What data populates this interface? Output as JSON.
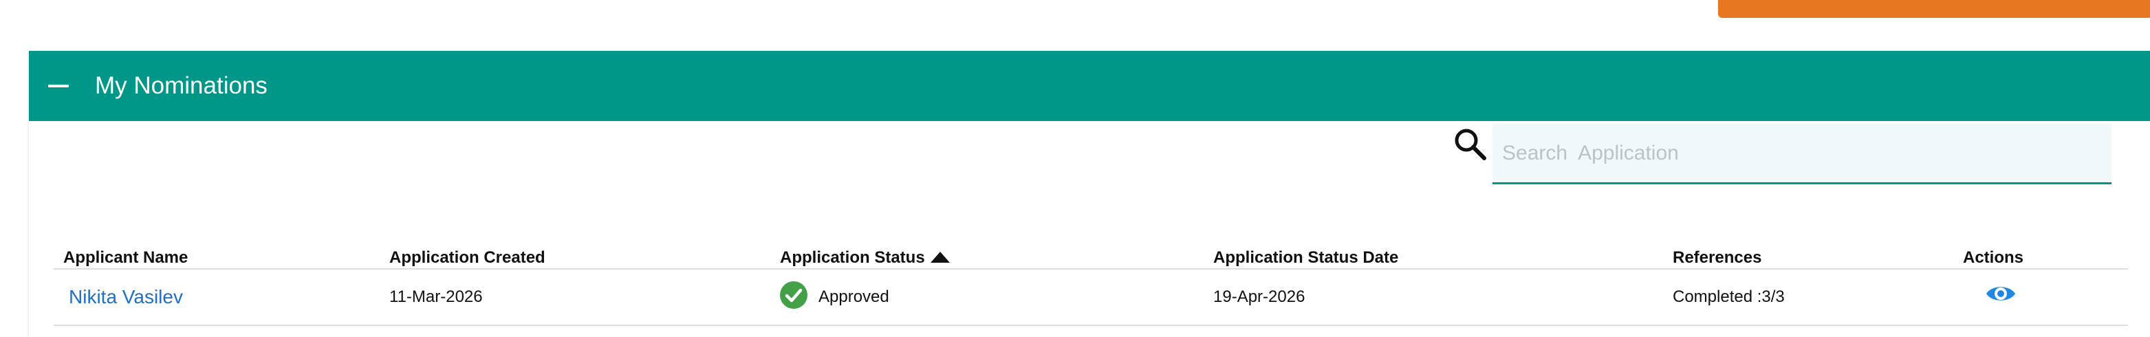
{
  "panel": {
    "title": "My Nominations"
  },
  "search": {
    "placeholder": "Search  Application",
    "value": ""
  },
  "table": {
    "columns": [
      "Applicant Name",
      "Application Created",
      "Application Status",
      "Application Status Date",
      "References",
      "Actions"
    ],
    "sort": {
      "column": "Application Status",
      "direction": "ascending"
    },
    "rows": [
      {
        "applicant_name": "Nikita Vasilev",
        "application_created": "11-Mar-2026",
        "status_icon": "check-circle-icon",
        "application_status": "Approved",
        "status_date": "19-Apr-2026",
        "references": "Completed :3/3",
        "action_icon": "view-eye-icon"
      }
    ]
  },
  "colors": {
    "header": "#009688",
    "accent_button": "#E87722",
    "link": "#1F6FC5",
    "approved": "#43A047",
    "action_icon": "#1E88E5"
  }
}
